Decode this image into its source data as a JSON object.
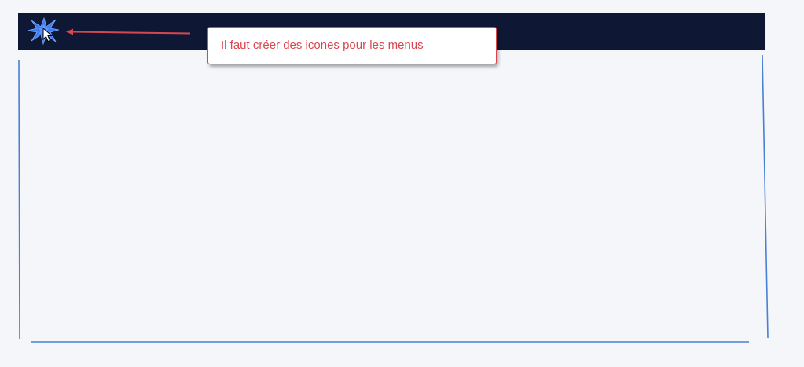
{
  "header": {
    "logo_icon": "starburst-logo-icon",
    "cursor_icon": "mouse-pointer-icon"
  },
  "annotation": {
    "text": "Il faut créer des icones pour les menus"
  },
  "colors": {
    "topbar": "#0e1733",
    "background": "#f4f6fa",
    "logo": "#3d7bf0",
    "annotation": "#d9474e",
    "frame_lines": "#4a7fd4"
  }
}
